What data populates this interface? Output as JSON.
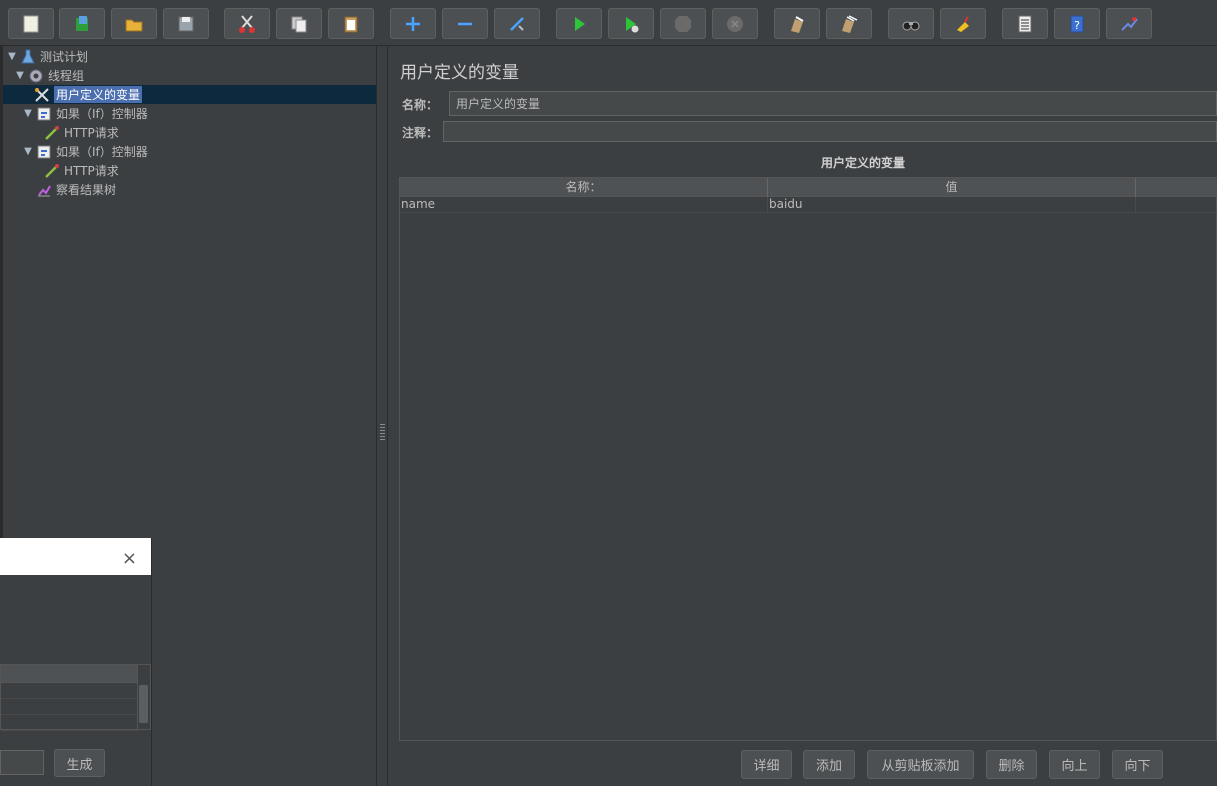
{
  "toolbar": {
    "buttons": [
      {
        "name": "new-icon"
      },
      {
        "name": "templates-icon"
      },
      {
        "name": "open-icon"
      },
      {
        "name": "save-icon"
      },
      {
        "name": "cut-icon"
      },
      {
        "name": "copy-icon"
      },
      {
        "name": "paste-icon"
      },
      {
        "name": "expand-icon"
      },
      {
        "name": "collapse-icon"
      },
      {
        "name": "toggle-icon"
      },
      {
        "name": "start-icon"
      },
      {
        "name": "start-no-pauses-icon"
      },
      {
        "name": "stop-icon"
      },
      {
        "name": "shutdown-icon"
      },
      {
        "name": "clear-icon"
      },
      {
        "name": "clear-all-icon"
      },
      {
        "name": "search-icon"
      },
      {
        "name": "reset-search-icon"
      },
      {
        "name": "function-helper-icon"
      },
      {
        "name": "help-icon"
      },
      {
        "name": "remote-icon"
      }
    ]
  },
  "tree": {
    "items": [
      {
        "label": "测试计划"
      },
      {
        "label": "线程组"
      },
      {
        "label": "用户定义的变量"
      },
      {
        "label": "如果（If）控制器"
      },
      {
        "label": "HTTP请求"
      },
      {
        "label": "如果（If）控制器"
      },
      {
        "label": "HTTP请求"
      },
      {
        "label": "察看结果树"
      }
    ]
  },
  "panel": {
    "title": "用户定义的变量",
    "name_label": "名称：",
    "name_value": "用户定义的变量",
    "comment_label": "注释：",
    "comment_value": "",
    "section_title": "用户定义的变量",
    "table": {
      "headers": [
        "名称：",
        "值",
        ""
      ],
      "rows": [
        [
          "name",
          "baidu",
          ""
        ]
      ]
    },
    "buttons": {
      "detail": "详细",
      "add": "添加",
      "add_clipboard": "从剪贴板添加",
      "delete": "删除",
      "up": "向上",
      "down": "向下"
    }
  },
  "dialog": {
    "close_icon": "×",
    "generate_label": "生成"
  }
}
